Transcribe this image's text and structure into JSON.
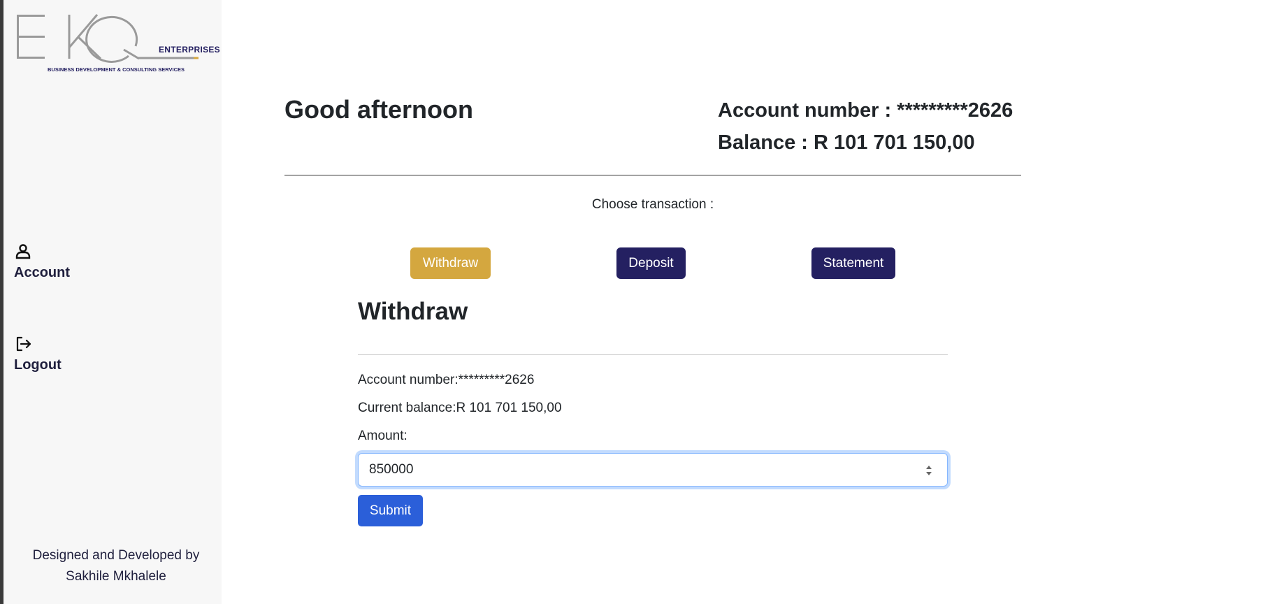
{
  "brand": {
    "logo_letters": "EKQ",
    "logo_word": "ENTERPRISES",
    "logo_tagline": "BUSINESS DEVELOPMENT & CONSULTING SERVICES",
    "accent_color": "#d4a73f",
    "primary_color": "#242061"
  },
  "sidebar": {
    "items": [
      {
        "label": "Account",
        "icon": "person-icon"
      },
      {
        "label": "Logout",
        "icon": "logout-icon"
      }
    ],
    "credit_line1": "Designed and Developed by",
    "credit_line2": "Sakhile Mkhalele"
  },
  "header": {
    "greeting": "Good afternoon",
    "account_number": "Account number : *********2626",
    "balance": "Balance : R 101 701 150,00"
  },
  "transactions": {
    "prompt": "Choose transaction :",
    "buttons": [
      "Withdraw",
      "Deposit",
      "Statement"
    ],
    "active": "Withdraw"
  },
  "withdraw_panel": {
    "title": "Withdraw",
    "account_number": "Account number:*********2626",
    "current_balance": "Current balance:R 101 701 150,00",
    "amount_label": "Amount:",
    "amount_value": "850000",
    "submit_label": "Submit"
  }
}
